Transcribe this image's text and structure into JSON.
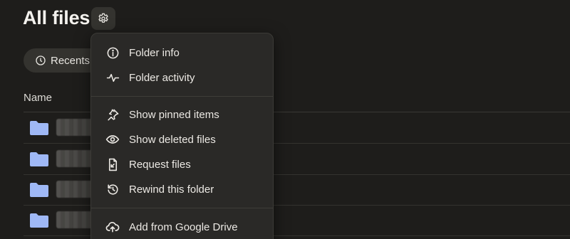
{
  "header": {
    "title": "All files"
  },
  "filters": {
    "recents_label": "Recents"
  },
  "table": {
    "column_name": "Name",
    "rows": [
      {
        "type": "folder",
        "name_redacted": true
      },
      {
        "type": "folder",
        "name_redacted": true
      },
      {
        "type": "folder",
        "name_redacted": true
      },
      {
        "type": "folder",
        "name_redacted": true
      }
    ]
  },
  "menu": {
    "groups": [
      [
        {
          "label": "Folder info",
          "icon": "info-icon"
        },
        {
          "label": "Folder activity",
          "icon": "activity-icon"
        }
      ],
      [
        {
          "label": "Show pinned items",
          "icon": "pin-icon"
        },
        {
          "label": "Show deleted files",
          "icon": "eye-icon"
        },
        {
          "label": "Request files",
          "icon": "request-file-icon"
        },
        {
          "label": "Rewind this folder",
          "icon": "rewind-icon"
        }
      ],
      [
        {
          "label": "Add from Google Drive",
          "icon": "cloud-upload-icon"
        }
      ]
    ]
  },
  "colors": {
    "background": "#1e1d1b",
    "menu_bg": "#2a2927",
    "folder_blue": "#9fb8f5",
    "text": "#ece9e4"
  }
}
